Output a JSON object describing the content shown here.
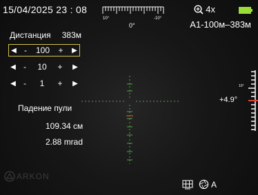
{
  "status_bar": {
    "datetime": "15/04/2025 23 : 08",
    "compass": {
      "left_tick_label": "10°",
      "center_label": "0°",
      "right_tick_label": "-10°"
    },
    "zoom": "4x",
    "battery_icon": "battery-full-icon",
    "profile": "A1-100м–383м"
  },
  "range_panel": {
    "distance_label": "Дистанция",
    "distance_value": "383м",
    "steppers": [
      {
        "minus": "-",
        "value": "100",
        "plus": "+",
        "selected": true
      },
      {
        "minus": "-",
        "value": "10",
        "plus": "+",
        "selected": false
      },
      {
        "minus": "-",
        "value": "1",
        "plus": "+",
        "selected": false
      }
    ]
  },
  "bullet_drop": {
    "title": "Падение пули",
    "cm": "109.34 см",
    "mrad": "2.88 mrad"
  },
  "tilt": {
    "scale_label": "10°",
    "value": "+4.9°"
  },
  "brand": {
    "logo_text": "ARKON"
  },
  "bottom_bar": {
    "mode_icon": "reticle-grid-icon",
    "shutter_icon": "shutter-icon",
    "shutter_mode": "A"
  },
  "colors": {
    "accent_yellow": "#d7c24a",
    "battery_green": "#9bdc3a",
    "tilt_red": "#e0453a",
    "reticle_green": "#5bbf4a"
  }
}
